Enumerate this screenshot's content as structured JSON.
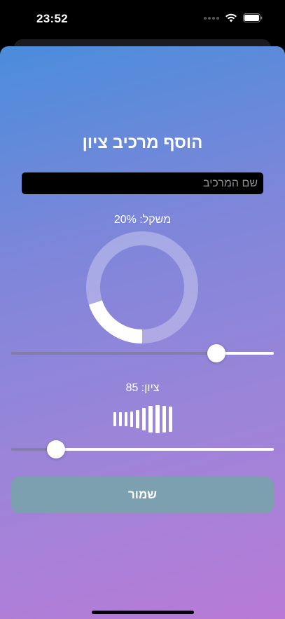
{
  "status_bar": {
    "time": "23:52",
    "icons": [
      "signal-icon",
      "wifi-icon",
      "battery-icon"
    ]
  },
  "sheet": {
    "title": "הוסף מרכיב ציון",
    "name_input": {
      "placeholder": "שם המרכיב",
      "value": ""
    },
    "weight": {
      "label": "משקל: 20%",
      "fraction": 0.2,
      "slider_fraction": 0.78
    },
    "score": {
      "label": "ציון: 85",
      "value": 85,
      "slider_fraction": 0.17
    },
    "save_label": "שמור"
  },
  "colors": {
    "accent": "#ffffff",
    "save_button": "#7da0b0",
    "gradient_top": "#4a8ddb",
    "gradient_bottom": "#b87ad6"
  }
}
